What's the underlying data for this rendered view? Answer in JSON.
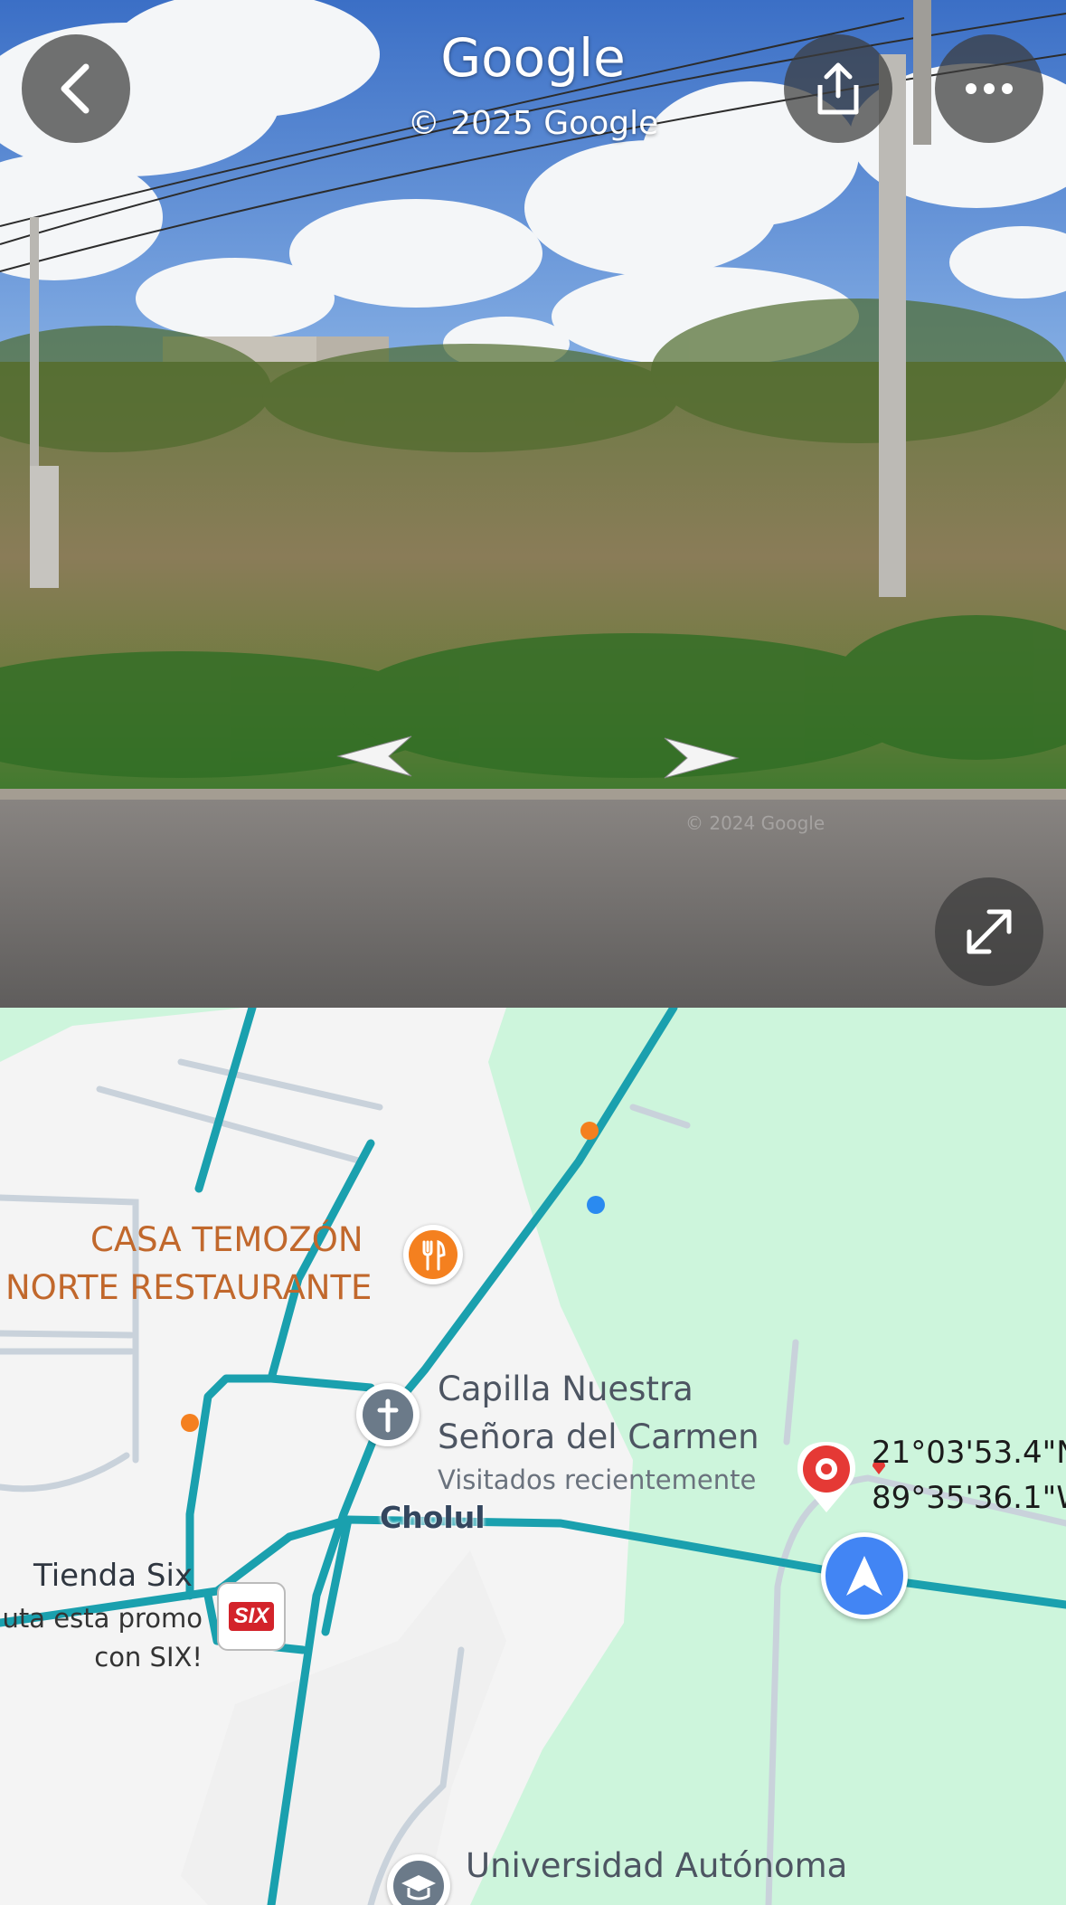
{
  "street_view": {
    "title": "Google",
    "copyright": "© 2025 Google",
    "watermark": "© 2024 Google",
    "buttons": {
      "back": "back-icon",
      "share": "share-icon",
      "more": "more-icon",
      "expand": "expand-icon"
    },
    "nav_arrows": [
      "left",
      "right"
    ]
  },
  "map": {
    "restaurant": {
      "line1": "CASA TEMOZÓN",
      "line2": "NORTE RESTAURANTE",
      "icon": "restaurant-icon"
    },
    "church": {
      "line1": "Capilla Nuestra",
      "line2": "Señora del Carmen",
      "subtitle": "Visitados recientemente",
      "icon": "church-icon"
    },
    "road": "Cholul",
    "pin": {
      "lat": "21°03'53.4\"N",
      "lng": "89°35'36.1\"W"
    },
    "store": {
      "name": "Tienda Six",
      "promo1": "uta esta promo",
      "promo2": "con SIX!",
      "logo": "SIX"
    },
    "university": {
      "line1": "Universidad Autónoma"
    },
    "colors": {
      "road": "#1aa0ae",
      "park": "#cdf5dc",
      "urban": "#f3f3f3",
      "pin": "#e53935",
      "location": "#4285f4"
    }
  }
}
